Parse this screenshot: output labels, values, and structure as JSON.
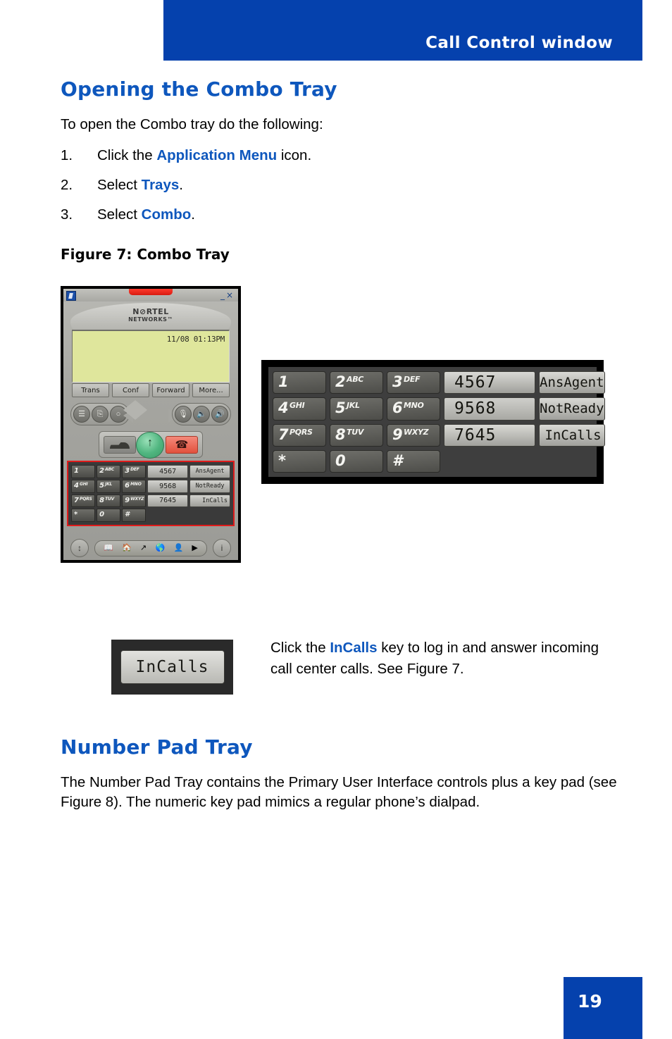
{
  "header": {
    "title": "Call Control window",
    "band_color": "#0541ad"
  },
  "section1": {
    "heading": "Opening the Combo Tray",
    "intro": "To open the Combo tray do the following:",
    "steps": [
      {
        "num": "1.",
        "pre": "Click the ",
        "bold": "Application Menu",
        "post": " icon."
      },
      {
        "num": "2.",
        "pre": "Select ",
        "bold": "Trays",
        "post": "."
      },
      {
        "num": "3.",
        "pre": "Select ",
        "bold": "Combo",
        "post": "."
      }
    ],
    "figure_caption": "Figure 7: Combo Tray"
  },
  "phone_app": {
    "window_buttons": {
      "minimize": "_",
      "close": "×"
    },
    "brand_name": "N⊘RTEL",
    "brand_sub": "NETWORKS™",
    "lcd_time": "11/08 01:13PM",
    "softkeys": [
      "Trans",
      "Conf",
      "Forward",
      "More..."
    ],
    "left_round_glyphs": [
      "☰",
      "⎘",
      "○"
    ],
    "right_round_glyphs": [
      "ᵍ",
      "◂",
      "◂"
    ],
    "bottom_icons": [
      "📖",
      "🏠",
      "↗",
      "🌐",
      "👤",
      "▶"
    ],
    "bottom_left_glyph": "↕",
    "bottom_right_glyph": "i"
  },
  "combo_tray": {
    "highlight_color": "#e01b1b",
    "dialpad": [
      {
        "digit": "1",
        "letters": ""
      },
      {
        "digit": "2",
        "letters": "ABC"
      },
      {
        "digit": "3",
        "letters": "DEF"
      },
      {
        "digit": "4",
        "letters": "GHI"
      },
      {
        "digit": "5",
        "letters": "JKL"
      },
      {
        "digit": "6",
        "letters": "MNO"
      },
      {
        "digit": "7",
        "letters": "PQRS"
      },
      {
        "digit": "8",
        "letters": "TUV"
      },
      {
        "digit": "9",
        "letters": "WXYZ"
      },
      {
        "digit": "*",
        "letters": ""
      },
      {
        "digit": "0",
        "letters": ""
      },
      {
        "digit": "#",
        "letters": ""
      }
    ],
    "line_keys": [
      "4567",
      "9568",
      "7645"
    ],
    "function_keys": [
      "AnsAgent",
      "NotReady",
      "InCalls"
    ]
  },
  "incalls_callout": {
    "button_label": "InCalls",
    "text_pre": "Click the ",
    "text_bold": "InCalls",
    "text_post": " key to log in and answer incoming call center calls. See Figure 7."
  },
  "section2": {
    "heading": "Number Pad Tray",
    "body": "The Number Pad Tray contains the Primary User Interface controls plus a key pad (see Figure 8). The numeric key pad mimics a regular phone’s dialpad."
  },
  "footer": {
    "page_number": "19"
  }
}
